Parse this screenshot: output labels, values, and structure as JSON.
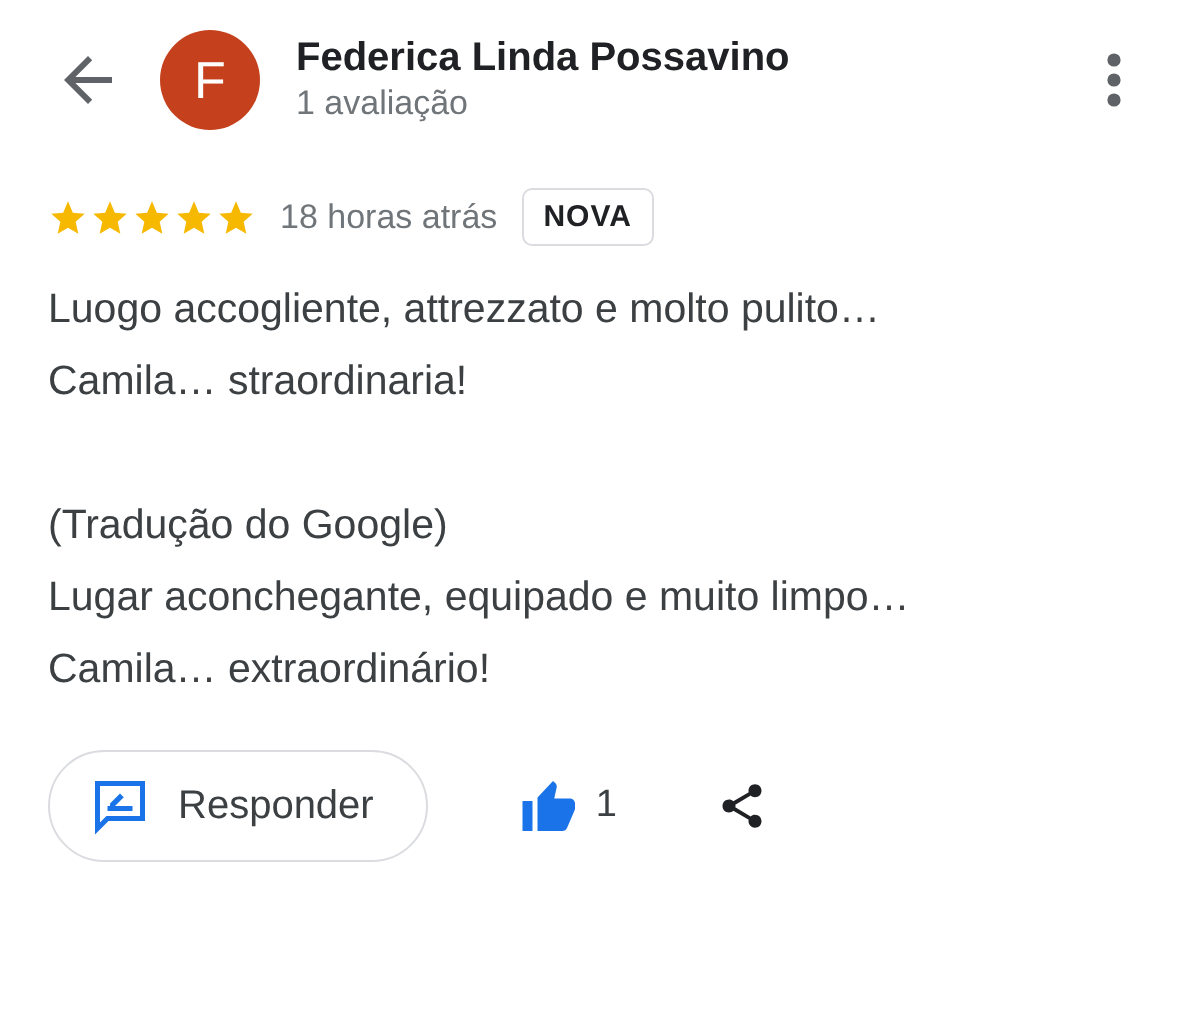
{
  "reviewer": {
    "initial": "F",
    "name": "Federica Linda Possavino",
    "review_count": "1 avaliação",
    "color": "#c5401c"
  },
  "review": {
    "stars": 5,
    "time": "18 horas atrás",
    "badge": "NOVA",
    "original_lines": [
      "Luogo accogliente, attrezzato e molto pulito…",
      "Camila… straordinaria!"
    ],
    "translation_label": "(Tradução do Google)",
    "translation_lines": [
      "Lugar aconchegante, equipado e muito limpo…",
      "Camila… extraordinário!"
    ]
  },
  "actions": {
    "reply_label": "Responder",
    "liked": true,
    "like_count": "1"
  }
}
